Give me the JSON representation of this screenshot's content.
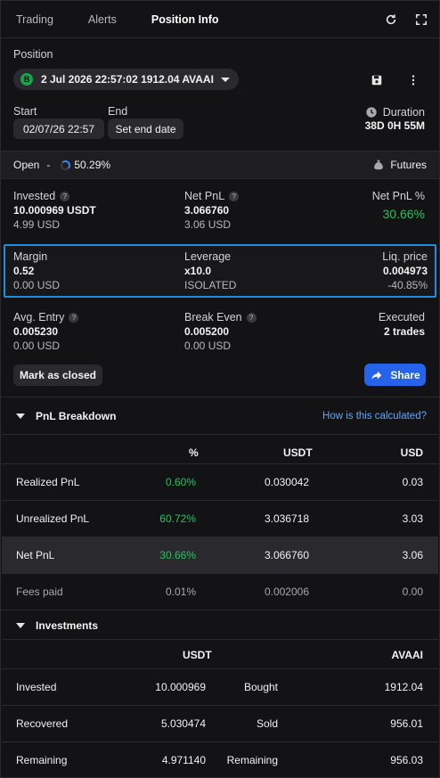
{
  "tabs": [
    {
      "label": "Trading",
      "active": false
    },
    {
      "label": "Alerts",
      "active": false
    },
    {
      "label": "Position Info",
      "active": true
    }
  ],
  "position": {
    "label": "Position",
    "badge": "B",
    "selected": "2 Jul 2026 22:57:02 1912.04 AVAAI"
  },
  "dates": {
    "start_label": "Start",
    "start_value": "02/07/26 22:57",
    "end_label": "End",
    "end_button": "Set end date",
    "duration_label": "Duration",
    "duration_value": "38D 0H 55M"
  },
  "status": {
    "open_label": "Open",
    "separator": "-",
    "progress": "50.29%",
    "market": "Futures"
  },
  "stats": {
    "invested": {
      "label": "Invested",
      "value": "10.000969 USDT",
      "sub": "4.99 USD"
    },
    "net_pnl": {
      "label": "Net PnL",
      "value": "3.066760",
      "sub": "3.06 USD"
    },
    "net_pnl_pct": {
      "label": "Net PnL %",
      "value": "30.66%"
    },
    "margin": {
      "label": "Margin",
      "value": "0.52",
      "sub": "0.00 USD"
    },
    "leverage": {
      "label": "Leverage",
      "value": "x10.0",
      "sub": "ISOLATED"
    },
    "liq_price": {
      "label": "Liq. price",
      "value": "0.004973",
      "sub": "-40.85%"
    },
    "avg_entry": {
      "label": "Avg. Entry",
      "value": "0.005230",
      "sub": "0.00 USD"
    },
    "break_even": {
      "label": "Break Even",
      "value": "0.005200",
      "sub": "0.00 USD"
    },
    "executed": {
      "label": "Executed",
      "value": "2 trades"
    }
  },
  "actions": {
    "mark_closed": "Mark as closed",
    "share": "Share"
  },
  "pnl_breakdown": {
    "title": "PnL Breakdown",
    "link": "How is this calculated?",
    "headers": [
      "%",
      "USDT",
      "USD"
    ],
    "rows": [
      {
        "label": "Realized PnL",
        "pct": "0.60%",
        "usdt": "0.030042",
        "usd": "0.03"
      },
      {
        "label": "Unrealized PnL",
        "pct": "60.72%",
        "usdt": "3.036718",
        "usd": "3.03"
      },
      {
        "label": "Net PnL",
        "pct": "30.66%",
        "usdt": "3.066760",
        "usd": "3.06"
      },
      {
        "label": "Fees paid",
        "pct": "0.01%",
        "usdt": "0.002006",
        "usd": "0.00"
      }
    ]
  },
  "investments": {
    "title": "Investments",
    "headers": [
      "USDT",
      "AVAAI"
    ],
    "rows": [
      {
        "label": "Invested",
        "usdt": "10.000969",
        "side": "Bought",
        "qty": "1912.04"
      },
      {
        "label": "Recovered",
        "usdt": "5.030474",
        "side": "Sold",
        "qty": "956.01"
      },
      {
        "label": "Remaining",
        "usdt": "4.971140",
        "side": "Remaining",
        "qty": "956.03"
      }
    ]
  },
  "colors": {
    "accent": "#2563eb",
    "positive": "#22c55e",
    "warning": "#f59e0b",
    "highlight_border": "#1d8fe0"
  }
}
